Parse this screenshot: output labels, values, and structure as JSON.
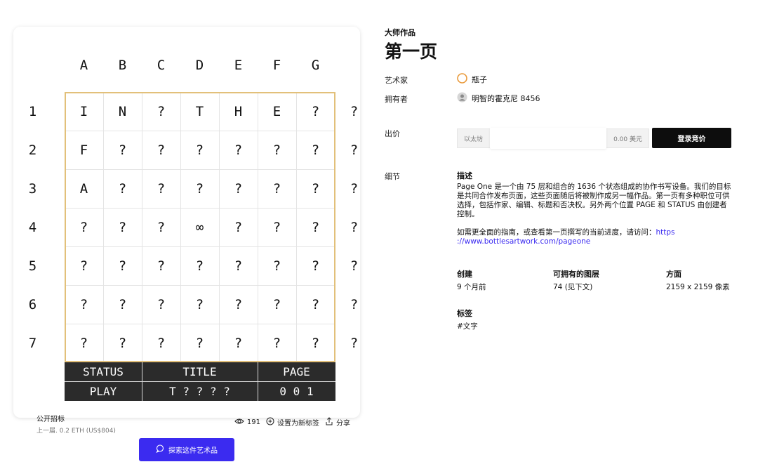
{
  "board": {
    "columns": [
      "A",
      "B",
      "C",
      "D",
      "E",
      "F",
      "G"
    ],
    "rows": [
      {
        "label": "1",
        "cells": [
          "I",
          "N",
          "?",
          "T",
          "H",
          "E",
          "?"
        ],
        "end": "?"
      },
      {
        "label": "2",
        "cells": [
          "F",
          "?",
          "?",
          "?",
          "?",
          "?",
          "?"
        ],
        "end": "?"
      },
      {
        "label": "3",
        "cells": [
          "A",
          "?",
          "?",
          "?",
          "?",
          "?",
          "?"
        ],
        "end": "?"
      },
      {
        "label": "4",
        "cells": [
          "?",
          "?",
          "?",
          "∞",
          "?",
          "?",
          "?"
        ],
        "end": "?"
      },
      {
        "label": "5",
        "cells": [
          "?",
          "?",
          "?",
          "?",
          "?",
          "?",
          "?"
        ],
        "end": "?"
      },
      {
        "label": "6",
        "cells": [
          "?",
          "?",
          "?",
          "?",
          "?",
          "?",
          "?"
        ],
        "end": "?"
      },
      {
        "label": "7",
        "cells": [
          "?",
          "?",
          "?",
          "?",
          "?",
          "?",
          "?"
        ],
        "end": "?"
      }
    ],
    "status_label": "STATUS",
    "status_value": "PLAY",
    "title_label": "TITLE",
    "title_value": "T ? ? ? ?",
    "page_label": "PAGE",
    "page_value": "0 0 1",
    "border_color": "#e2c07a"
  },
  "auction": {
    "type": "公开招标",
    "last_sale": "上一届. 0.2 ETH (US$804)"
  },
  "actions": {
    "views": "191",
    "set_tag": "设置为新标签",
    "share": "分享"
  },
  "explore_button": "探索这件艺术品",
  "artwork": {
    "eyebrow": "大师作品",
    "title": "第一页",
    "artist_label": "艺术家",
    "artist_name": "瓶子",
    "owner_label": "拥有者",
    "owner_name": "明智的霍克尼 8456",
    "bid_label": "出价",
    "bid_currency": "以太坊",
    "bid_usd": "0.00 美元",
    "bid_button": "登录竞价",
    "details_label": "细节",
    "desc_heading": "描述",
    "desc_p1": "Page One 是一个由 75 层和组合的 1636 个状态组成的协作书写设备。我们的目标是共同合作发布页面，这些页面随后将被制作成另一幅作品。第一页有多种职位可供选择，包括作家、编辑、标题和否决权。另外两个位置 PAGE 和 STATUS 由创建者控制。",
    "desc_p2": "如需更全面的指南，或查看第一页撰写的当前进度，请访问：",
    "desc_link": "https ://www.bottlesartwork.com/pageone",
    "created_label": "创建",
    "created_value": "9 个月前",
    "layers_label": "可拥有的图层",
    "layers_value": "74 (见下文)",
    "dim_label": "方面",
    "dim_value": "2159 x 2159 像素",
    "tags_label": "标签",
    "tags_value": "#文字",
    "accent_color": "#3b2bf0"
  }
}
